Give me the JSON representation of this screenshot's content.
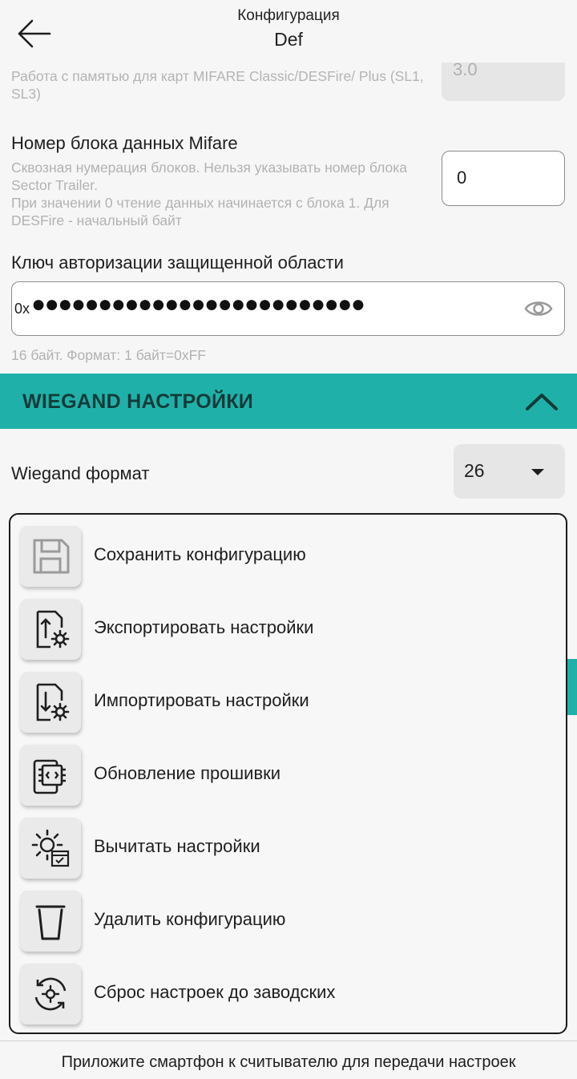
{
  "header": {
    "title": "Конфигурация",
    "subtitle": "Def",
    "back_icon": "arrow-left-icon"
  },
  "cutoff": {
    "text": "Работа с памятью для карт MIFARE Classic/DESFire/ Plus (SL1, SL3)",
    "value": "3.0"
  },
  "mifare_block": {
    "label": "Номер блока данных Mifare",
    "hint": "Сквозная нумерация блоков. Нельзя указывать номер блока Sector Trailer.\nПри значении 0 чтение данных начинается с блока 1. Для DESFire - начальный байт",
    "value": "0"
  },
  "auth_key": {
    "label": "Ключ авторизации защищенной области",
    "prefix": "0x",
    "masked": "●●●●●●●●●●●●●●●●●●●●●●●●●",
    "hint": "16 байт. Формат: 1 байт=0xFF",
    "eye_icon": "eye-icon"
  },
  "wiegand": {
    "section_title": "WIEGAND НАСТРОЙКИ",
    "format_label": "Wiegand формат",
    "format_value": "26",
    "accent": "#1fb1a9"
  },
  "menu": {
    "items": [
      {
        "label": "Сохранить конфигурацию",
        "icon": "save-icon"
      },
      {
        "label": "Экспортировать настройки",
        "icon": "export-icon"
      },
      {
        "label": "Импортировать настройки",
        "icon": "import-icon"
      },
      {
        "label": "Обновление прошивки",
        "icon": "firmware-icon"
      },
      {
        "label": "Вычитать настройки",
        "icon": "read-settings-icon"
      },
      {
        "label": "Удалить конфигурацию",
        "icon": "trash-icon"
      },
      {
        "label": "Сброс настроек до заводских",
        "icon": "factory-reset-icon"
      }
    ]
  },
  "footer": {
    "text": "Приложите смартфон к считывателю для передачи настроек"
  }
}
